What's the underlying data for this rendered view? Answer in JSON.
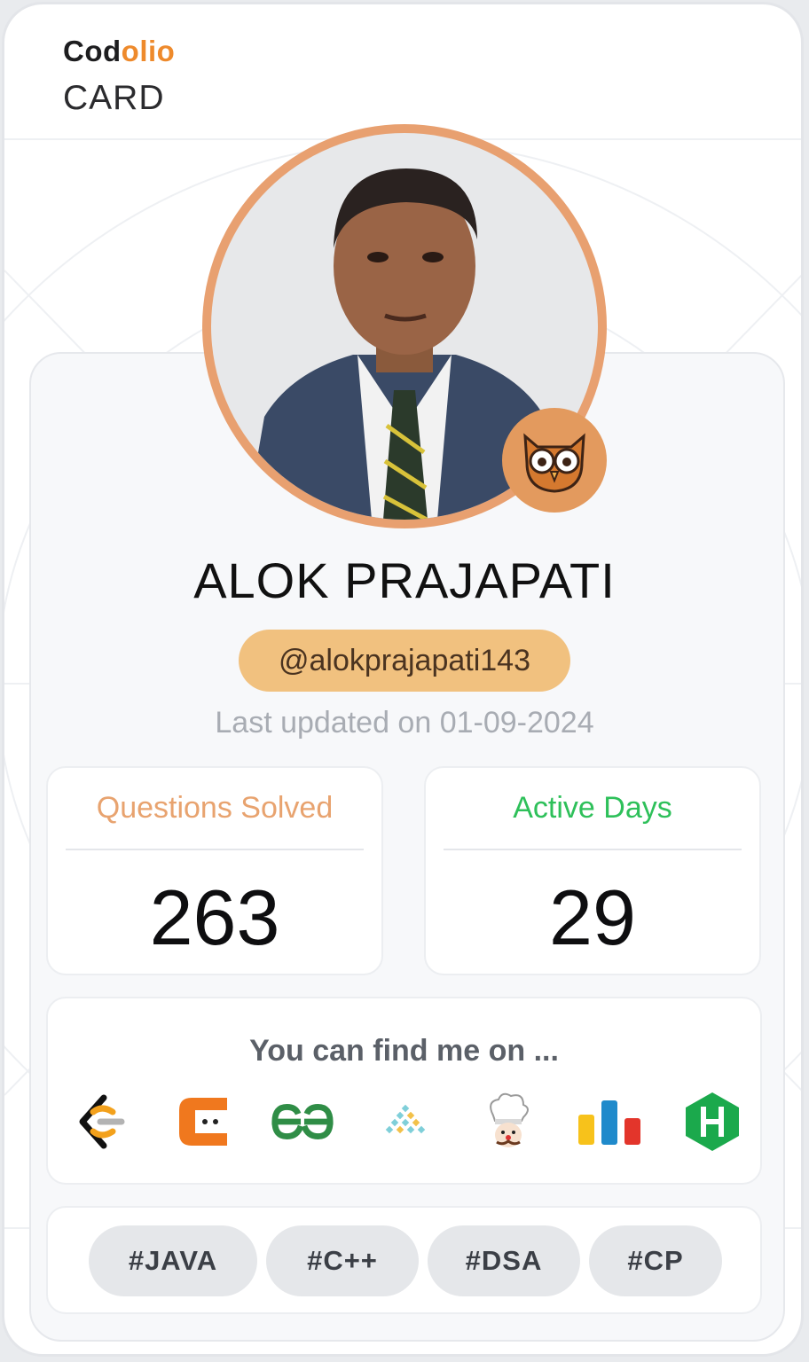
{
  "brand": {
    "part1": "Cod",
    "part2": "olio",
    "subtitle": "CARD"
  },
  "profile": {
    "name": "ALOK PRAJAPATI",
    "handle": "@alokprajapati143",
    "updated": "Last updated on 01-09-2024",
    "badge_icon": "owl-icon"
  },
  "stats": [
    {
      "label": "Questions Solved",
      "value": "263",
      "color": "#e8a36f"
    },
    {
      "label": "Active Days",
      "value": "29",
      "color": "#2ec05a"
    }
  ],
  "find": {
    "title": "You can find me on ...",
    "platforms": [
      "leetcode-icon",
      "codestudio-icon",
      "geeksforgeeks-icon",
      "interviewbit-icon",
      "codechef-icon",
      "codeforces-icon",
      "hackerrank-icon"
    ]
  },
  "tags": [
    "#JAVA",
    "#C++",
    "#DSA",
    "#CP"
  ],
  "colors": {
    "accent": "#ee8a2c",
    "ring": "#e8a070",
    "handle_bg": "#f1c17f",
    "green": "#2ec05a"
  }
}
